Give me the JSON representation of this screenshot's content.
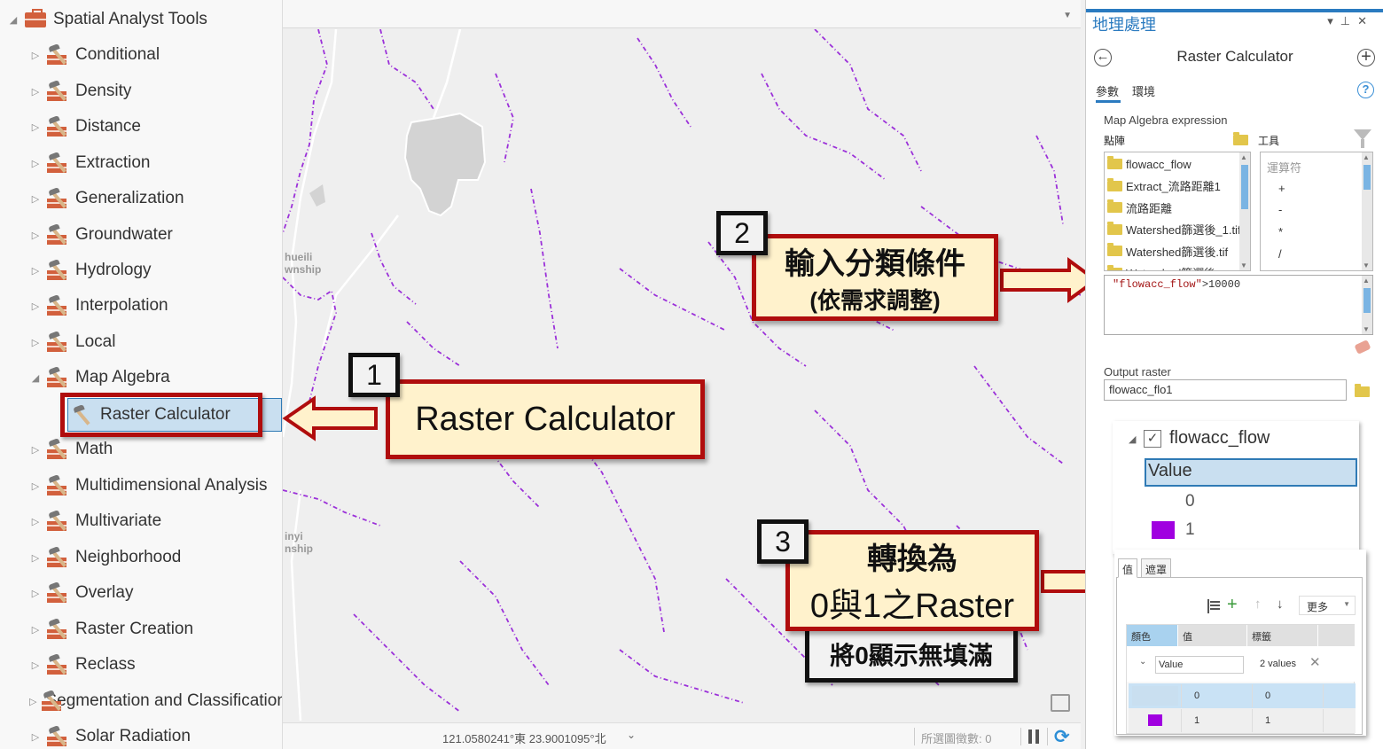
{
  "catalog_tree": {
    "root": {
      "label": "Spatial Analyst Tools",
      "icon": "toolbox-icon",
      "expanded": true
    },
    "toolsets": [
      {
        "label": "Conditional",
        "expanded": false
      },
      {
        "label": "Density",
        "expanded": false
      },
      {
        "label": "Distance",
        "expanded": false
      },
      {
        "label": "Extraction",
        "expanded": false
      },
      {
        "label": "Generalization",
        "expanded": false
      },
      {
        "label": "Groundwater",
        "expanded": false
      },
      {
        "label": "Hydrology",
        "expanded": false
      },
      {
        "label": "Interpolation",
        "expanded": false
      },
      {
        "label": "Local",
        "expanded": false
      },
      {
        "label": "Map Algebra",
        "expanded": true
      },
      {
        "label": "Math",
        "expanded": false
      },
      {
        "label": "Multidimensional Analysis",
        "expanded": false
      },
      {
        "label": "Multivariate",
        "expanded": false
      },
      {
        "label": "Neighborhood",
        "expanded": false
      },
      {
        "label": "Overlay",
        "expanded": false
      },
      {
        "label": "Raster Creation",
        "expanded": false
      },
      {
        "label": "Reclass",
        "expanded": false
      },
      {
        "label": "Segmentation and Classification",
        "expanded": false
      },
      {
        "label": "Solar Radiation",
        "expanded": false
      }
    ],
    "selected_tool": {
      "label": "Raster Calculator",
      "icon": "hammer-icon",
      "parent": "Map Algebra"
    }
  },
  "map": {
    "labels": [
      {
        "text": "hueili\nwnship"
      },
      {
        "text": "inyi\nnship"
      }
    ],
    "stream_color": "#9b30d9",
    "status": {
      "coordinates": "121.0580241°東 23.9001095°北",
      "selected_features": "所選圖徵數: 0"
    }
  },
  "callouts": [
    {
      "number": "1",
      "text": "Raster Calculator"
    },
    {
      "number": "2",
      "text": "輸入分類條件",
      "subtext": "(依需求調整)"
    },
    {
      "number": "3",
      "text": "轉換為",
      "subtext": "0與1之Raster",
      "note": "將0顯示無填滿"
    }
  ],
  "geoprocessing": {
    "pane_title": "地理處理",
    "tool_title": "Raster Calculator",
    "tabs": [
      "參數",
      "環境"
    ],
    "active_tab": "參數",
    "expression_label": "Map Algebra expression",
    "rasters_label": "點陣",
    "tools_label": "工具",
    "rasters": [
      "flowacc_flow",
      "Extract_流路距離1",
      "流路距離",
      "Watershed篩選後_1.tif",
      "Watershed篩選後.tif",
      "Watershed篩選後..."
    ],
    "operators_header": "運算符",
    "operators": [
      "+",
      "-",
      "*",
      "/"
    ],
    "expression_raster": "\"flowacc_flow\"",
    "expression_rest": ">10000",
    "output_label": "Output raster",
    "output_value": "flowacc_flo1"
  },
  "layer_legend": {
    "layer_name": "flowacc_flow",
    "checked": true,
    "field": "Value",
    "classes": [
      {
        "label": "0",
        "color": null
      },
      {
        "label": "1",
        "color": "#a000e0"
      }
    ]
  },
  "symbology": {
    "tabs": [
      "值",
      "遮罩"
    ],
    "more_label": "更多",
    "headers": [
      "顏色",
      "值",
      "標籤"
    ],
    "group": {
      "field": "Value",
      "count": "2 values"
    },
    "rows": [
      {
        "color": "#c9dff0",
        "value": "0",
        "label": "0",
        "selected": true
      },
      {
        "color": "#a000e0",
        "value": "1",
        "label": "1",
        "selected": false
      }
    ]
  }
}
